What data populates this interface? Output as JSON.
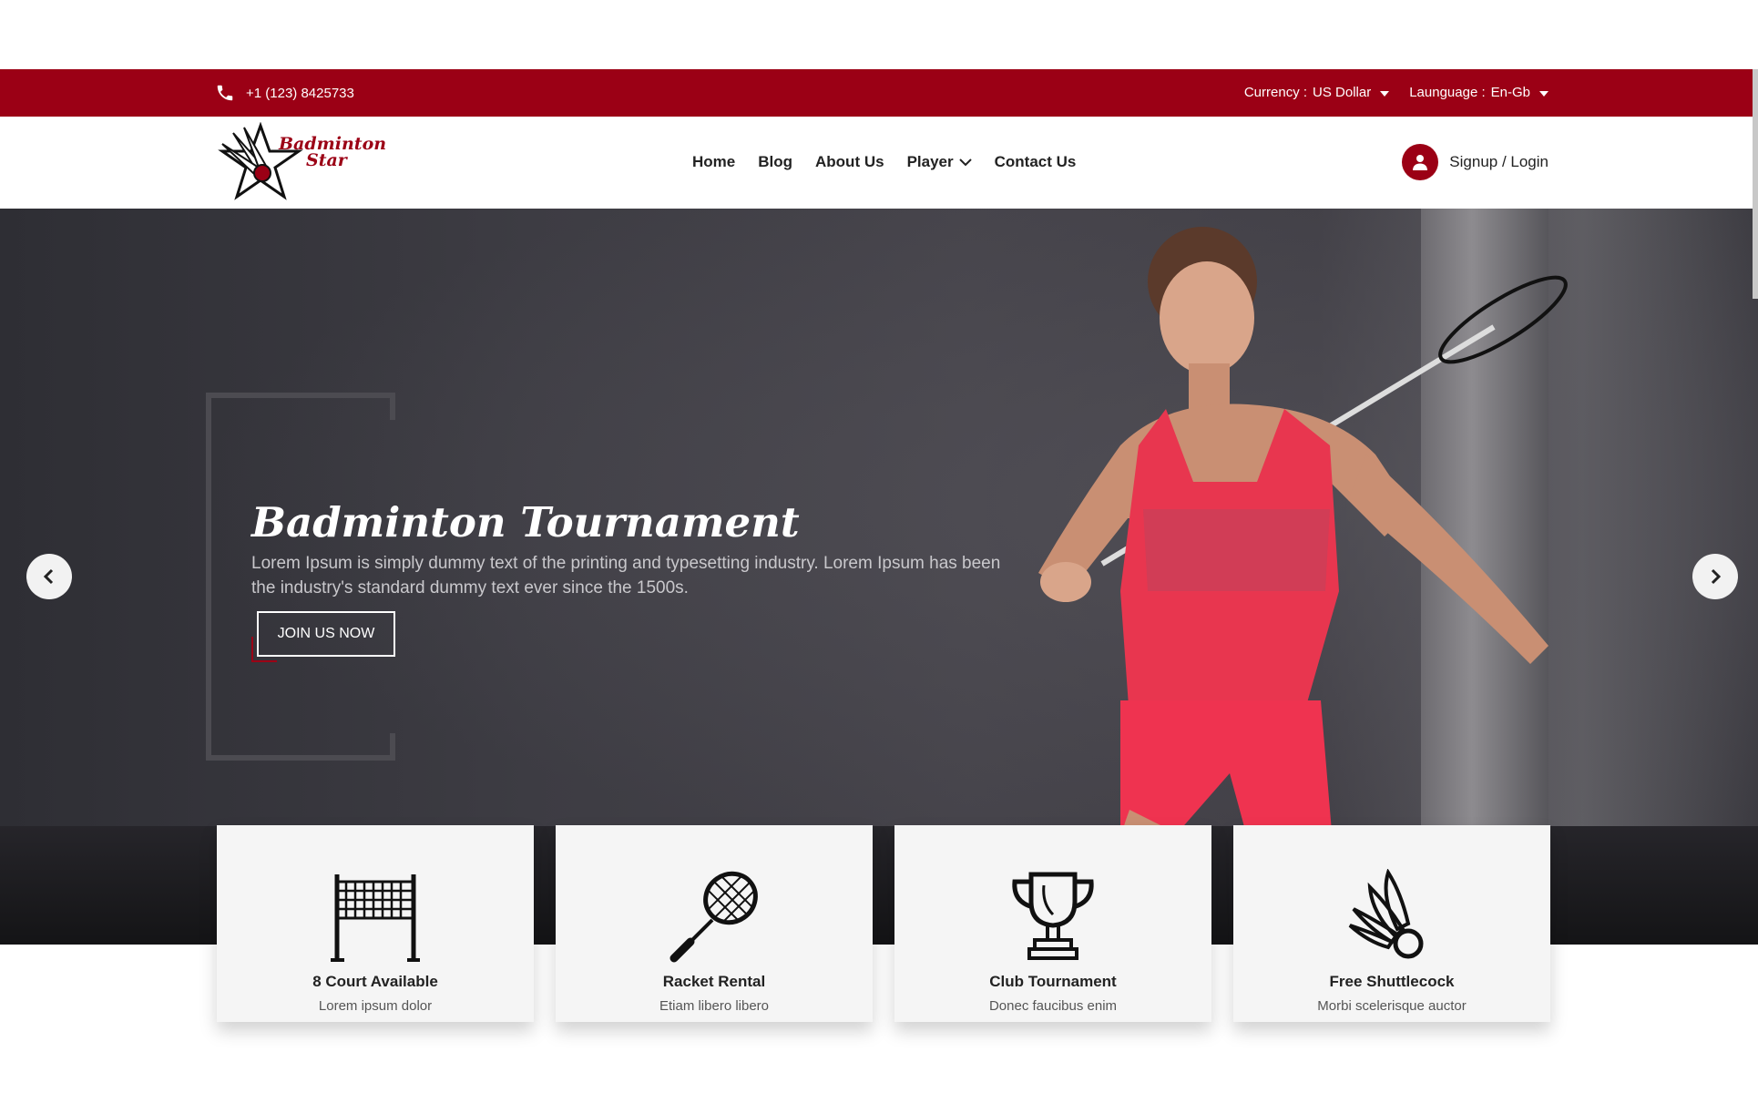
{
  "topbar": {
    "phone": "+1 (123) 8425733",
    "currency_label": "Currency :",
    "currency_value": "US Dollar",
    "language_label": "Lаunguage :",
    "language_value": "En-Gb"
  },
  "header": {
    "logo_text_1": "Badminton",
    "logo_text_2": "Star",
    "nav": [
      "Home",
      "Blog",
      "About Us",
      "Player",
      "Contact Us"
    ],
    "account": "Signup / Login"
  },
  "hero": {
    "title": "Badminton Tournament",
    "text": "Lorem Ipsum is simply dummy text of the printing and typesetting industry. Lorem Ipsum has been the industry's standard dummy text ever since the 1500s.",
    "cta": "JOIN US NOW"
  },
  "features": [
    {
      "icon": "net-icon",
      "title": "8 Court Available",
      "subtitle": "Lorem ipsum dolor"
    },
    {
      "icon": "racket-icon",
      "title": "Racket Rental",
      "subtitle": "Etiam libero libero"
    },
    {
      "icon": "trophy-icon",
      "title": "Club Tournament",
      "subtitle": "Donec faucibus enim"
    },
    {
      "icon": "shuttlecock-icon",
      "title": "Free Shuttlecock",
      "subtitle": "Morbi scelerisque auctor"
    }
  ],
  "colors": {
    "brand": "#9b0015",
    "hero_bg": "#3d3c43",
    "card_bg": "#f5f5f5"
  }
}
